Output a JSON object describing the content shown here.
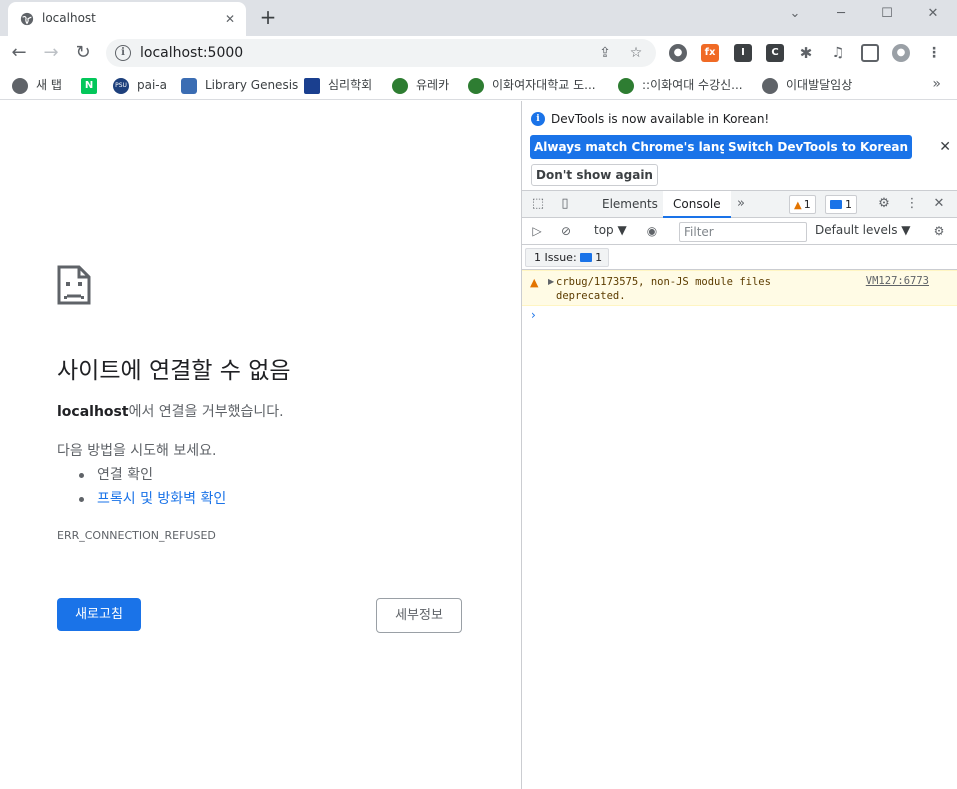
{
  "browser": {
    "tab_title": "localhost",
    "tab_close": "✕",
    "new_tab": "+",
    "url": "localhost:5000",
    "window_controls": {
      "minimize": "─",
      "maximize": "☐",
      "close": "✕",
      "tabsearch": "⌄"
    }
  },
  "bookmarks": [
    {
      "label": "새 탭",
      "icon": "globe-icon",
      "color": "#5f6368",
      "glyph": ""
    },
    {
      "label": "",
      "icon": "naver-icon",
      "color": "#03c75a",
      "glyph": "N"
    },
    {
      "label": "pai-a",
      "icon": "psu-icon",
      "color": "#1e407c",
      "glyph": "PSU"
    },
    {
      "label": "Library Genesis",
      "icon": "libgen-icon",
      "color": "#3b6db3",
      "glyph": ""
    },
    {
      "label": "심리학회",
      "icon": "kpa-icon",
      "color": "#1a3f8f",
      "glyph": ""
    },
    {
      "label": "유레카",
      "icon": "ewha-icon",
      "color": "#2e7d32",
      "glyph": ""
    },
    {
      "label": "이화여자대학교 도...",
      "icon": "ewha-icon",
      "color": "#2e7d32",
      "glyph": ""
    },
    {
      "label": "::이화여대 수강신...",
      "icon": "ewha-icon",
      "color": "#2e7d32",
      "glyph": ""
    },
    {
      "label": "이대발달임상",
      "icon": "globe-icon",
      "color": "#5f6368",
      "glyph": ""
    }
  ],
  "bookmarks_more": "»",
  "error_page": {
    "title": "사이트에 연결할 수 없음",
    "host": "localhost",
    "desc_suffix": "에서 연결을 거부했습니다.",
    "try_text": "다음 방법을 시도해 보세요.",
    "suggestions": [
      "연결 확인",
      "프록시 및 방화벽 확인"
    ],
    "error_code": "ERR_CONNECTION_REFUSED",
    "reload_label": "새로고침",
    "details_label": "세부정보"
  },
  "devtools": {
    "banner_text": "DevTools is now available in Korean!",
    "btn_match": "Always match Chrome's language",
    "btn_switch": "Switch DevTools to Korean",
    "btn_dont_show": "Don't show again",
    "tab_elements": "Elements",
    "tab_console": "Console",
    "warn_count": "1",
    "msg_count": "1",
    "context": "top ▼",
    "filter_placeholder": "Filter",
    "levels": "Default levels ▼",
    "issues_label": "1 Issue:",
    "issues_count": "1",
    "warning_text": "crbug/1173575, non-JS module files deprecated.",
    "warning_source": "VM127:6773"
  },
  "colors": {
    "accent": "#1a73e8",
    "warning_bg": "#fffbe5",
    "warning": "#e37400"
  }
}
